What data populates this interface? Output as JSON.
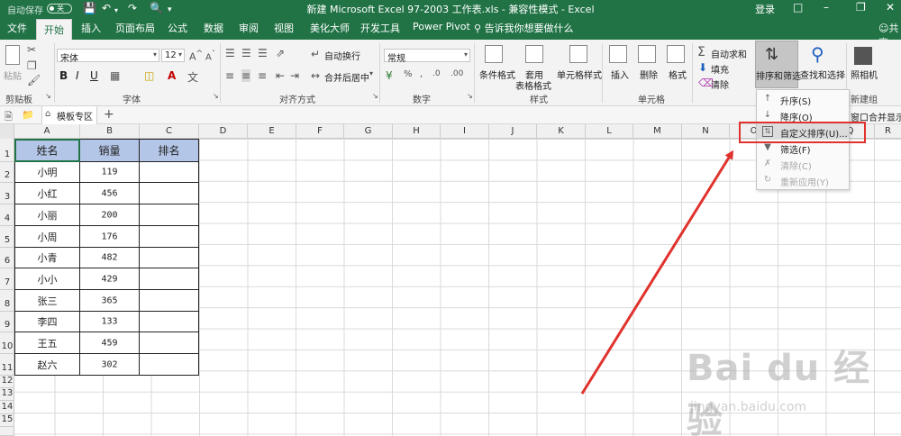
{
  "titlebar": {
    "autosave": "自动保存",
    "autosave_state": "关",
    "title": "新建 Microsoft Excel 97-2003 工作表.xls  -  兼容性模式  -  Excel",
    "login": "登录"
  },
  "tabs": [
    "文件",
    "开始",
    "插入",
    "页面布局",
    "公式",
    "数据",
    "审阅",
    "视图",
    "美化大师",
    "开发工具",
    "Power Pivot"
  ],
  "active_tab": "开始",
  "tell_me": "告诉我你想要做什么",
  "share": "共享",
  "ribbon": {
    "paste": "粘贴",
    "clipboard": "剪贴板",
    "font_name": "宋体",
    "font_size": "12",
    "font": "字体",
    "wrap": "自动换行",
    "merge": "合并后居中",
    "alignment": "对齐方式",
    "number_format": "常规",
    "number": "数字",
    "cond_format": "条件格式",
    "table_format_1": "套用",
    "table_format_2": "表格格式",
    "cell_style": "单元格样式",
    "styles": "样式",
    "insert": "插入",
    "delete": "删除",
    "format": "格式",
    "cells": "单元格",
    "autosum": "自动求和",
    "fill": "填充",
    "clear": "清除",
    "sort_filter": "排序和筛选",
    "find_select": "查找和选择",
    "camera": "照相机",
    "new_group": "新建组"
  },
  "template_bar": {
    "tab": "模板专区",
    "add": "+",
    "right_text": "窗口合并显示"
  },
  "columns": [
    "A",
    "B",
    "C",
    "D",
    "E",
    "F",
    "G",
    "H",
    "I",
    "J",
    "K",
    "L",
    "M",
    "N",
    "O",
    "P",
    "Q",
    "R"
  ],
  "rows": [
    "1",
    "2",
    "3",
    "4",
    "5",
    "6",
    "7",
    "8",
    "9",
    "10",
    "11",
    "12",
    "13",
    "14",
    "15"
  ],
  "table": {
    "headers": [
      "姓名",
      "销量",
      "排名"
    ],
    "rows": [
      [
        "小明",
        "119",
        ""
      ],
      [
        "小红",
        "456",
        ""
      ],
      [
        "小丽",
        "200",
        ""
      ],
      [
        "小周",
        "176",
        ""
      ],
      [
        "小青",
        "482",
        ""
      ],
      [
        "小小",
        "429",
        ""
      ],
      [
        "张三",
        "365",
        ""
      ],
      [
        "李四",
        "133",
        ""
      ],
      [
        "王五",
        "459",
        ""
      ],
      [
        "赵六",
        "302",
        ""
      ]
    ]
  },
  "sort_menu": [
    {
      "label": "升序(S)",
      "icon": "sort-ascending-icon",
      "enabled": true
    },
    {
      "label": "降序(O)",
      "icon": "sort-descending-icon",
      "enabled": true
    },
    {
      "label": "自定义排序(U)...",
      "icon": "custom-sort-icon",
      "enabled": true
    },
    {
      "label": "筛选(F)",
      "icon": "filter-icon",
      "enabled": true
    },
    {
      "label": "清除(C)",
      "icon": "clear-filter-icon",
      "enabled": false
    },
    {
      "label": "重新应用(Y)",
      "icon": "reapply-icon",
      "enabled": false
    }
  ],
  "colors": {
    "excel_green": "#217346",
    "header_fill": "#b4c6e7",
    "annotation_red": "#e0322d"
  },
  "watermark": {
    "logo": "Bai du 经验",
    "url": "jingyan.baidu.com"
  }
}
